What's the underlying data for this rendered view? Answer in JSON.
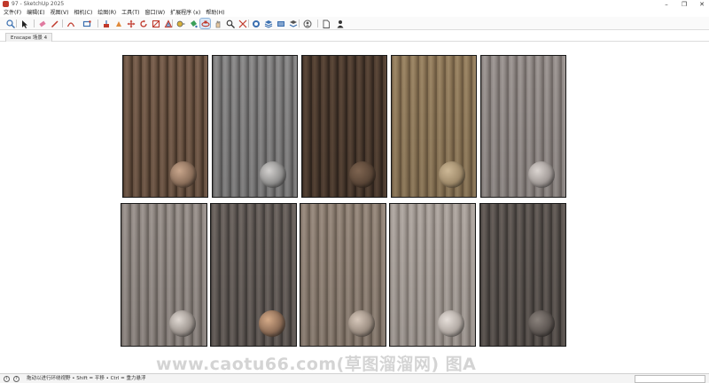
{
  "window": {
    "title": "97 - SketchUp 2025",
    "controls": [
      "–",
      "❐",
      "✕"
    ]
  },
  "menu": {
    "items": [
      "文件(F)",
      "编辑(E)",
      "视图(V)",
      "相机(C)",
      "绘图(R)",
      "工具(T)",
      "窗口(W)",
      "扩展程序 (x)",
      "帮助(H)"
    ]
  },
  "toolbar": {
    "tools": [
      {
        "icon": "zoom-icon",
        "active": false
      },
      {
        "icon": "select-arrow-icon",
        "active": false
      },
      {
        "icon": "eraser-icon",
        "active": false
      },
      {
        "icon": "pencil-icon",
        "active": false
      },
      {
        "icon": "arc-icon",
        "active": false
      },
      {
        "icon": "rectangle-icon",
        "active": false
      },
      {
        "icon": "push-pull-icon",
        "active": false
      },
      {
        "icon": "follow-me-icon",
        "active": false
      },
      {
        "icon": "move-icon",
        "active": false
      },
      {
        "icon": "rotate-icon",
        "active": false
      },
      {
        "icon": "scale-icon",
        "active": false
      },
      {
        "icon": "offset-icon",
        "active": false
      },
      {
        "icon": "tape-measure-icon",
        "active": false
      },
      {
        "icon": "paint-bucket-icon",
        "active": false
      },
      {
        "icon": "orbit-icon",
        "active": true
      },
      {
        "icon": "pan-icon",
        "active": false
      },
      {
        "icon": "zoom-window-icon",
        "active": false
      },
      {
        "icon": "zoom-extents-icon",
        "active": false
      },
      {
        "icon": "warehouse-icon",
        "active": false
      },
      {
        "icon": "extension-warehouse-icon",
        "active": false
      },
      {
        "icon": "layout-icon",
        "active": false
      },
      {
        "icon": "extension-manager-icon",
        "active": false
      },
      {
        "icon": "account-icon",
        "active": false
      },
      {
        "icon": "new-file-icon",
        "active": false
      },
      {
        "icon": "user-icon",
        "active": false
      }
    ]
  },
  "scene_tab": {
    "label": "Enscape 场景 4"
  },
  "panels": [
    {
      "name": "wood-panel-1",
      "base": "#6b5443",
      "light": "#806654",
      "dark": "#4a382b",
      "knob": "#8a6e5a",
      "knob_light": "#c9a68c"
    },
    {
      "name": "wood-panel-2",
      "base": "#7d7c7c",
      "light": "#929191",
      "dark": "#5e5d5d",
      "knob": "#8f8e8d",
      "knob_light": "#d3d1cf"
    },
    {
      "name": "wood-panel-3",
      "base": "#4b3a2e",
      "light": "#5e4a3b",
      "dark": "#33271f",
      "knob": "#5a4637",
      "knob_light": "#7e6450"
    },
    {
      "name": "wood-panel-4",
      "base": "#8b7556",
      "light": "#a08a69",
      "dark": "#6e5b42",
      "knob": "#9f8a6a",
      "knob_light": "#cdb896"
    },
    {
      "name": "wood-panel-5",
      "base": "#8e8784",
      "light": "#a39c99",
      "dark": "#726b68",
      "knob": "#a09996",
      "knob_light": "#dbd5d1"
    },
    {
      "name": "wood-panel-6",
      "base": "#8d8580",
      "light": "#a29a95",
      "dark": "#6f6863",
      "knob": "#9d958f",
      "knob_light": "#e0d9d3"
    },
    {
      "name": "wood-panel-7",
      "base": "#5f5854",
      "light": "#736b66",
      "dark": "#45403d",
      "knob": "#8b6b55",
      "knob_light": "#d6ab88"
    },
    {
      "name": "wood-panel-8",
      "base": "#8a7c70",
      "light": "#9e9084",
      "dark": "#6e6257",
      "knob": "#9a8c80",
      "knob_light": "#d7c8bb"
    },
    {
      "name": "wood-panel-9",
      "base": "#a29a94",
      "light": "#b6aea8",
      "dark": "#857d77",
      "knob": "#b0a8a2",
      "knob_light": "#e6dfda"
    },
    {
      "name": "wood-panel-10",
      "base": "#56504c",
      "light": "#6a625d",
      "dark": "#3f3a37",
      "knob": "#5c5551",
      "knob_light": "#8a827c"
    }
  ],
  "watermark": {
    "text": "www.caotu66.com(草图溜溜网) 图A"
  },
  "status": {
    "text": "拖动以进行环绕视野 • Shift = 平移 • Ctrl = 重力悬浮",
    "icons": [
      "info-icon",
      "help-icon"
    ]
  }
}
